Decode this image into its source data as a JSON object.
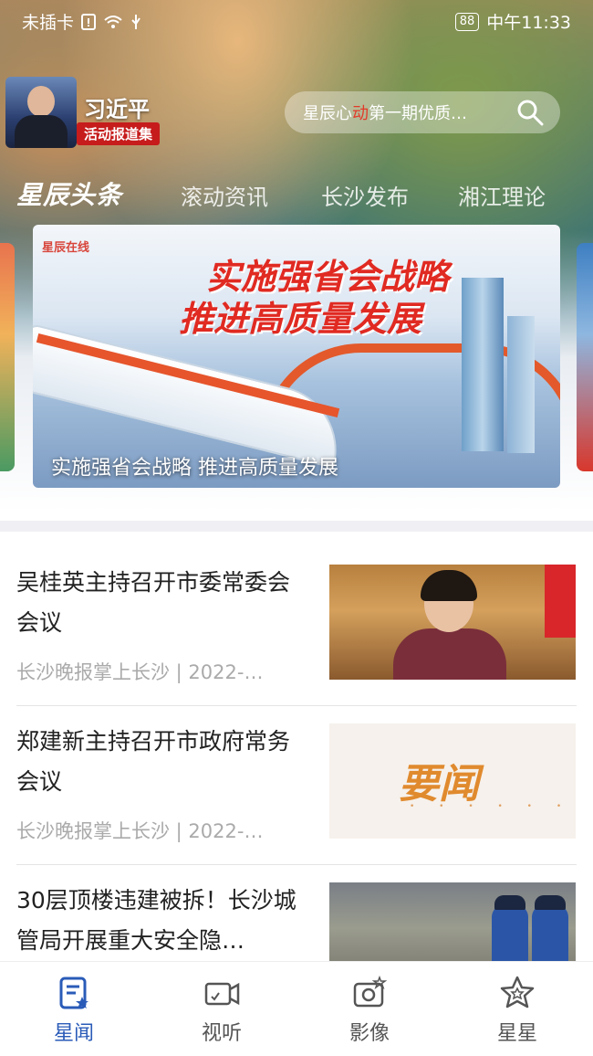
{
  "status_bar": {
    "carrier": "未插卡",
    "battery": "88",
    "time": "中午11:33"
  },
  "header": {
    "xi_banner": {
      "name": "习近平",
      "subtitle": "活动报道集"
    },
    "search": {
      "text_prefix": "星辰心",
      "text_highlight": "动",
      "text_suffix": "第一期优质…"
    },
    "brand": "星辰头条",
    "tabs": [
      "滚动资讯",
      "长沙发布",
      "湘江理论"
    ]
  },
  "carousel": {
    "logo": "星辰在线",
    "headline_line1": "实施强省会战略",
    "headline_line2": "推进高质量发展",
    "caption": "实施强省会战略 推进高质量发展"
  },
  "news": [
    {
      "title": "吴桂英主持召开市委常委会会议",
      "meta": "长沙晚报掌上长沙 | 2022-…"
    },
    {
      "title": "郑建新主持召开市政府常务会议",
      "meta": "长沙晚报掌上长沙 | 2022-…",
      "thumb_text": "要闻"
    },
    {
      "title": "30层顶楼违建被拆！长沙城管局开展重大安全隐…",
      "meta": ""
    }
  ],
  "bottom_nav": [
    {
      "label": "星闻",
      "icon": "news-icon",
      "active": true
    },
    {
      "label": "视听",
      "icon": "video-icon",
      "active": false
    },
    {
      "label": "影像",
      "icon": "camera-icon",
      "active": false
    },
    {
      "label": "星星",
      "icon": "star-icon",
      "active": false
    }
  ],
  "colors": {
    "accent": "#2a5bb8",
    "highlight_red": "#e23a2a",
    "badge_red": "#c61c1c"
  }
}
